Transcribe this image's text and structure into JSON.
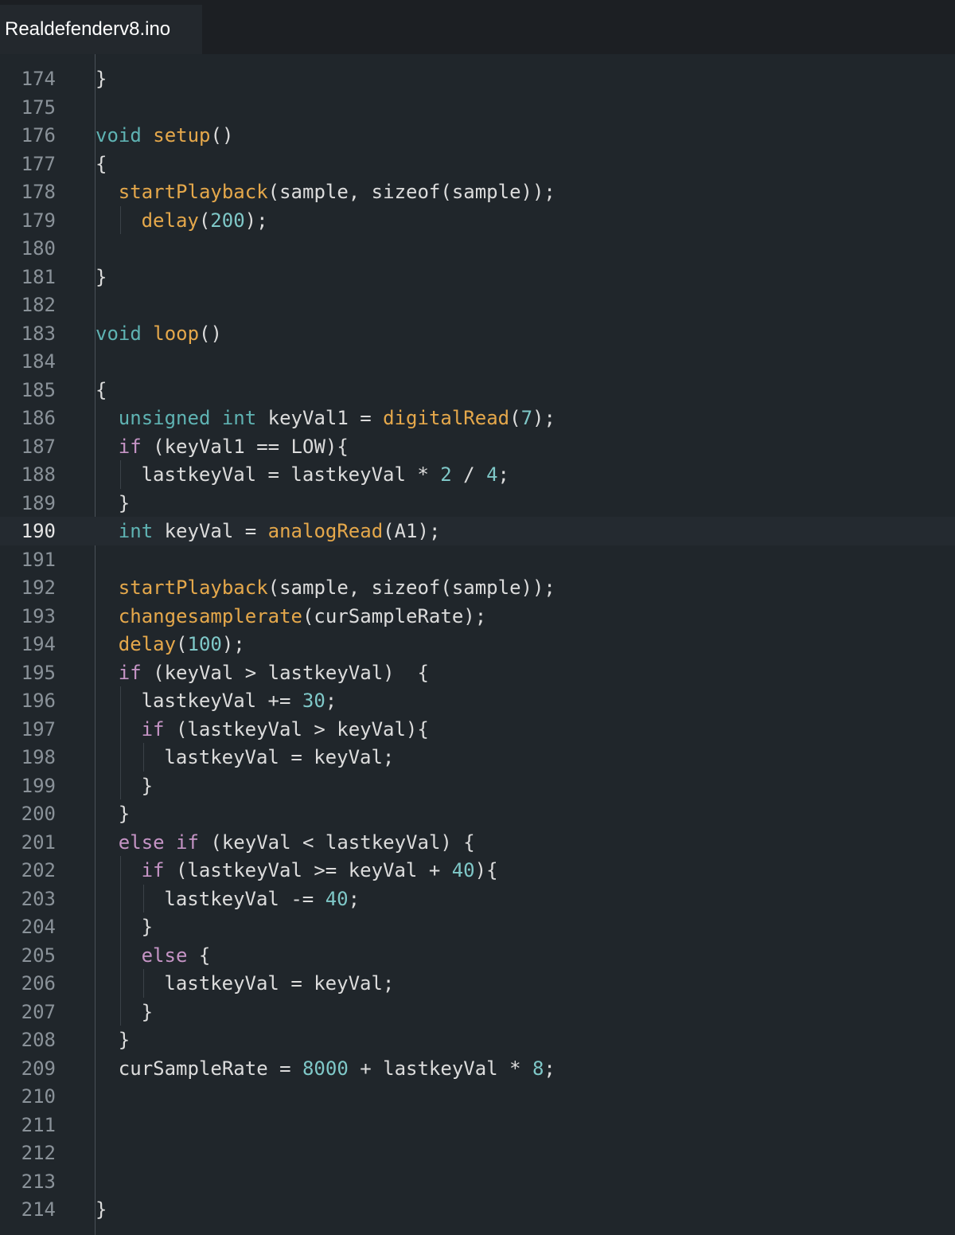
{
  "tab": {
    "filename": "Realdefenderv8.ino"
  },
  "colors": {
    "background": "#20262b",
    "keyword": "#5fb3b3",
    "control": "#c594c5",
    "function": "#e5a84b",
    "number": "#7fc8c8",
    "text": "#dcdcdc",
    "line_number": "#8a9299"
  },
  "current_line": "190",
  "lines": [
    {
      "n": "174",
      "indent": 0,
      "tokens": [
        [
          "p",
          "}"
        ]
      ]
    },
    {
      "n": "175",
      "indent": 0,
      "tokens": []
    },
    {
      "n": "176",
      "indent": 0,
      "tokens": [
        [
          "k",
          "void"
        ],
        [
          "p",
          " "
        ],
        [
          "f",
          "setup"
        ],
        [
          "p",
          "()"
        ]
      ]
    },
    {
      "n": "177",
      "indent": 0,
      "tokens": [
        [
          "p",
          "{"
        ]
      ]
    },
    {
      "n": "178",
      "indent": 1,
      "tokens": [
        [
          "f",
          "startPlayback"
        ],
        [
          "p",
          "(sample, sizeof(sample));"
        ]
      ]
    },
    {
      "n": "179",
      "indent": 2,
      "tokens": [
        [
          "f",
          "delay"
        ],
        [
          "p",
          "("
        ],
        [
          "n",
          "200"
        ],
        [
          "p",
          ");"
        ]
      ]
    },
    {
      "n": "180",
      "indent": 0,
      "tokens": []
    },
    {
      "n": "181",
      "indent": 0,
      "tokens": [
        [
          "p",
          "}"
        ]
      ]
    },
    {
      "n": "182",
      "indent": 0,
      "tokens": []
    },
    {
      "n": "183",
      "indent": 0,
      "tokens": [
        [
          "k",
          "void"
        ],
        [
          "p",
          " "
        ],
        [
          "f",
          "loop"
        ],
        [
          "p",
          "()"
        ]
      ]
    },
    {
      "n": "184",
      "indent": 0,
      "tokens": []
    },
    {
      "n": "185",
      "indent": 0,
      "tokens": [
        [
          "p",
          "{"
        ]
      ]
    },
    {
      "n": "186",
      "indent": 1,
      "tokens": [
        [
          "k",
          "unsigned"
        ],
        [
          "p",
          " "
        ],
        [
          "k",
          "int"
        ],
        [
          "p",
          " keyVal1 = "
        ],
        [
          "f",
          "digitalRead"
        ],
        [
          "p",
          "("
        ],
        [
          "n",
          "7"
        ],
        [
          "p",
          ");"
        ]
      ]
    },
    {
      "n": "187",
      "indent": 1,
      "tokens": [
        [
          "c",
          "if"
        ],
        [
          "p",
          " (keyVal1 == LOW){"
        ]
      ]
    },
    {
      "n": "188",
      "indent": 2,
      "tokens": [
        [
          "p",
          "lastkeyVal = lastkeyVal * "
        ],
        [
          "n",
          "2"
        ],
        [
          "p",
          " / "
        ],
        [
          "n",
          "4"
        ],
        [
          "p",
          ";"
        ]
      ]
    },
    {
      "n": "189",
      "indent": 1,
      "tokens": [
        [
          "p",
          "}"
        ]
      ]
    },
    {
      "n": "190",
      "indent": 1,
      "tokens": [
        [
          "k",
          "int"
        ],
        [
          "p",
          " keyVal = "
        ],
        [
          "f",
          "analogRead"
        ],
        [
          "p",
          "(A1);"
        ]
      ]
    },
    {
      "n": "191",
      "indent": 0,
      "tokens": []
    },
    {
      "n": "192",
      "indent": 1,
      "tokens": [
        [
          "f",
          "startPlayback"
        ],
        [
          "p",
          "(sample, sizeof(sample));"
        ]
      ]
    },
    {
      "n": "193",
      "indent": 1,
      "tokens": [
        [
          "f",
          "changesamplerate"
        ],
        [
          "p",
          "(curSampleRate);"
        ]
      ]
    },
    {
      "n": "194",
      "indent": 1,
      "tokens": [
        [
          "f",
          "delay"
        ],
        [
          "p",
          "("
        ],
        [
          "n",
          "100"
        ],
        [
          "p",
          ");"
        ]
      ]
    },
    {
      "n": "195",
      "indent": 1,
      "tokens": [
        [
          "c",
          "if"
        ],
        [
          "p",
          " (keyVal > lastkeyVal)  {"
        ]
      ]
    },
    {
      "n": "196",
      "indent": 2,
      "tokens": [
        [
          "p",
          "lastkeyVal += "
        ],
        [
          "n",
          "30"
        ],
        [
          "p",
          ";"
        ]
      ]
    },
    {
      "n": "197",
      "indent": 2,
      "tokens": [
        [
          "c",
          "if"
        ],
        [
          "p",
          " (lastkeyVal > keyVal){"
        ]
      ]
    },
    {
      "n": "198",
      "indent": 3,
      "tokens": [
        [
          "p",
          "lastkeyVal = keyVal;"
        ]
      ]
    },
    {
      "n": "199",
      "indent": 2,
      "tokens": [
        [
          "p",
          "}"
        ]
      ]
    },
    {
      "n": "200",
      "indent": 1,
      "tokens": [
        [
          "p",
          "}"
        ]
      ]
    },
    {
      "n": "201",
      "indent": 1,
      "tokens": [
        [
          "c",
          "else"
        ],
        [
          "p",
          " "
        ],
        [
          "c",
          "if"
        ],
        [
          "p",
          " (keyVal < lastkeyVal) {"
        ]
      ]
    },
    {
      "n": "202",
      "indent": 2,
      "tokens": [
        [
          "c",
          "if"
        ],
        [
          "p",
          " (lastkeyVal >= keyVal + "
        ],
        [
          "n",
          "40"
        ],
        [
          "p",
          "){"
        ]
      ]
    },
    {
      "n": "203",
      "indent": 3,
      "tokens": [
        [
          "p",
          "lastkeyVal -= "
        ],
        [
          "n",
          "40"
        ],
        [
          "p",
          ";"
        ]
      ]
    },
    {
      "n": "204",
      "indent": 2,
      "tokens": [
        [
          "p",
          "}"
        ]
      ]
    },
    {
      "n": "205",
      "indent": 2,
      "tokens": [
        [
          "c",
          "else"
        ],
        [
          "p",
          " {"
        ]
      ]
    },
    {
      "n": "206",
      "indent": 3,
      "tokens": [
        [
          "p",
          "lastkeyVal = keyVal;"
        ]
      ]
    },
    {
      "n": "207",
      "indent": 2,
      "tokens": [
        [
          "p",
          "}"
        ]
      ]
    },
    {
      "n": "208",
      "indent": 1,
      "tokens": [
        [
          "p",
          "}"
        ]
      ]
    },
    {
      "n": "209",
      "indent": 1,
      "tokens": [
        [
          "p",
          "curSampleRate = "
        ],
        [
          "n",
          "8000"
        ],
        [
          "p",
          " + lastkeyVal * "
        ],
        [
          "n",
          "8"
        ],
        [
          "p",
          ";"
        ]
      ]
    },
    {
      "n": "210",
      "indent": 0,
      "tokens": []
    },
    {
      "n": "211",
      "indent": 0,
      "tokens": []
    },
    {
      "n": "212",
      "indent": 0,
      "tokens": []
    },
    {
      "n": "213",
      "indent": 0,
      "tokens": []
    },
    {
      "n": "214",
      "indent": 0,
      "tokens": [
        [
          "p",
          "}"
        ]
      ]
    }
  ]
}
